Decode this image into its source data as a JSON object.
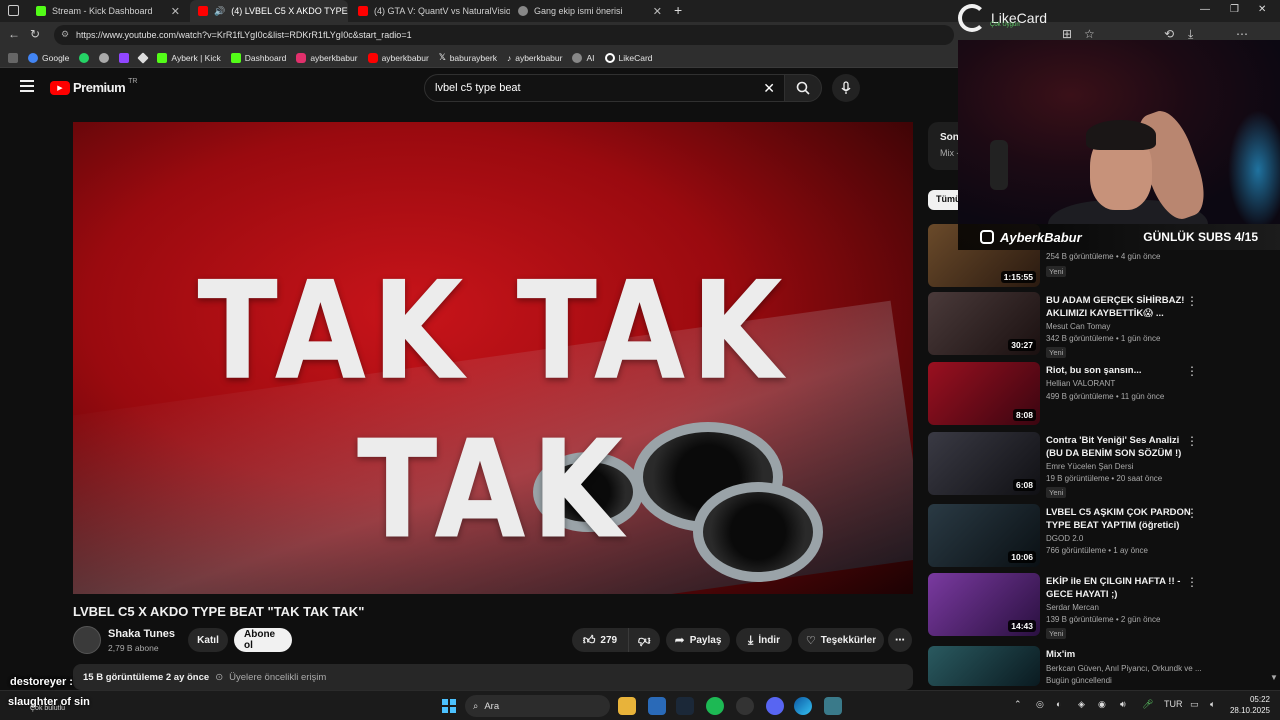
{
  "browser": {
    "tabs": [
      {
        "title": "Stream - Kick Dashboard",
        "color": "#53fc18"
      },
      {
        "title": "(4) LVBEL C5 X AKDO TYPE B",
        "color": "#ff0000"
      },
      {
        "title": "(4) GTA V: QuantV vs NaturalVisio",
        "color": "#ff0000"
      },
      {
        "title": "Gang ekip ismi önerisi",
        "color": "#888888"
      }
    ],
    "url": "https://www.youtube.com/watch?v=KrR1fLYgI0c&list=RDKrR1fLYgI0c&start_radio=1",
    "bookmarks": [
      {
        "label": "Google",
        "color": "#4285f4"
      },
      {
        "label": "",
        "color": "#25d366"
      },
      {
        "label": "",
        "color": "#aaaaaa"
      },
      {
        "label": "",
        "color": "#9146ff"
      },
      {
        "label": "",
        "color": "#dddddd"
      },
      {
        "label": "Ayberk | Kick",
        "color": "#53fc18"
      },
      {
        "label": "Dashboard",
        "color": "#53fc18"
      },
      {
        "label": "ayberkbabur",
        "color": "#e1306c"
      },
      {
        "label": "ayberkbabur",
        "color": "#ff0000"
      },
      {
        "label": "baburayberk",
        "color": "#ffffff"
      },
      {
        "label": "ayberkbabur",
        "color": "#ffffff"
      },
      {
        "label": "AI",
        "color": "#aaaaaa"
      },
      {
        "label": "LikeCard",
        "color": "#ffffff"
      }
    ]
  },
  "youtube": {
    "logo": "Premium",
    "region": "TR",
    "search_query": "lvbel c5 type beat",
    "video_overlay_text": "TAK TAK TAK",
    "video_title": "LVBEL C5 X AKDO TYPE BEAT \"TAK TAK TAK\"",
    "channel": "Shaka Tunes",
    "channel_subs": "2,79 B abone",
    "join_label": "Katıl",
    "subscribe_label": "Abone ol",
    "likes": "279",
    "share_label": "Paylaş",
    "download_label": "İndir",
    "thanks_label": "Teşekkürler",
    "description_meta": "15 B görüntüleme  2 ay önce",
    "description_extra": "Üyelere öncelikli erişim",
    "sidebar_top_title": "Son",
    "sidebar_top_sub": "Mix -",
    "chip_all": "Tümü",
    "recommendations": [
      {
        "title": "",
        "channel": "",
        "meta": "254 B görüntüleme • 4 gün önce",
        "badge": "Yeni",
        "duration": "1:15:55",
        "thumb": "#6a4a2a"
      },
      {
        "title": "BU ADAM GERÇEK SİHİRBAZ! AKLIMIZI KAYBETTİK😱 ...",
        "channel": "Mesut Can Tomay",
        "meta": "342 B görüntüleme • 1 gün önce",
        "badge": "Yeni",
        "duration": "30:27",
        "thumb": "#3a2a2a"
      },
      {
        "title": "Riot, bu son şansın...",
        "channel": "Hellian VALORANT",
        "meta": "499 B görüntüleme • 11 gün önce",
        "badge": "",
        "duration": "8:08",
        "thumb": "#7a1020"
      },
      {
        "title": "Contra 'Bit Yeniği' Ses Analizi (BU DA BENİM SON SÖZÜM !)",
        "channel": "Emre Yücelen Şan Dersi",
        "meta": "19 B görüntüleme • 20 saat önce",
        "badge": "Yeni",
        "duration": "6:08",
        "thumb": "#2a2a30"
      },
      {
        "title": "LVBEL C5 AŞKIM ÇOK PARDON TYPE BEAT YAPTIM (öğretici)",
        "channel": "DGOD 2.0",
        "meta": "766 görüntüleme • 1 ay önce",
        "badge": "",
        "duration": "10:06",
        "thumb": "#1f2a30"
      },
      {
        "title": "EKİP ile EN ÇILGIN HAFTA !! - GECE HAYATI ;)",
        "channel": "Serdar Mercan",
        "meta": "139 B görüntüleme • 2 gün önce",
        "badge": "Yeni",
        "duration": "14:43",
        "thumb": "#5a2a80"
      },
      {
        "title": "Mix'im",
        "channel": "Berkcan Güven, Anıl Piyancı, Orkundk ve ...",
        "meta": "Bugün güncellendi",
        "badge": "",
        "duration": "",
        "thumb": "#203a40"
      }
    ]
  },
  "stream_overlay": {
    "brand": "LikeCard",
    "brand_sub": "Çok Uygun",
    "instagram": "AyberkBabur",
    "subs_goal": "GÜNLÜK SUBS 4/15",
    "chat_user": "destoreyer :",
    "now_playing": "slaughter of sin",
    "now_playing_sub": "Çok bulutlu"
  },
  "taskbar": {
    "search_placeholder": "Ara",
    "lang": "TUR",
    "time": "05:22",
    "date": "28.10.2025"
  }
}
